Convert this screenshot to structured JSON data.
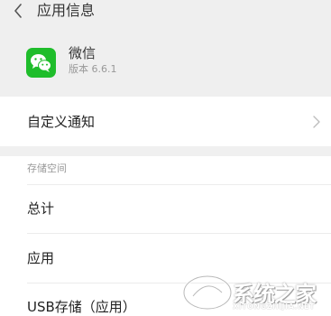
{
  "header": {
    "title": "应用信息",
    "back_icon": "back-arrow-icon"
  },
  "app": {
    "name": "微信",
    "version": "版本 6.6.1",
    "icon": "wechat-icon",
    "icon_color": "#1fbd2b"
  },
  "settings": {
    "custom_notification_label": "自定义通知",
    "chevron_icon": "chevron-right-icon"
  },
  "storage": {
    "section_title": "存储空间",
    "rows": [
      {
        "label": "总计"
      },
      {
        "label": "应用"
      },
      {
        "label": "USB存储（应用）"
      }
    ]
  },
  "watermark": {
    "text": "系统之家",
    "sub": "XITONGZHIJIA.NET"
  }
}
